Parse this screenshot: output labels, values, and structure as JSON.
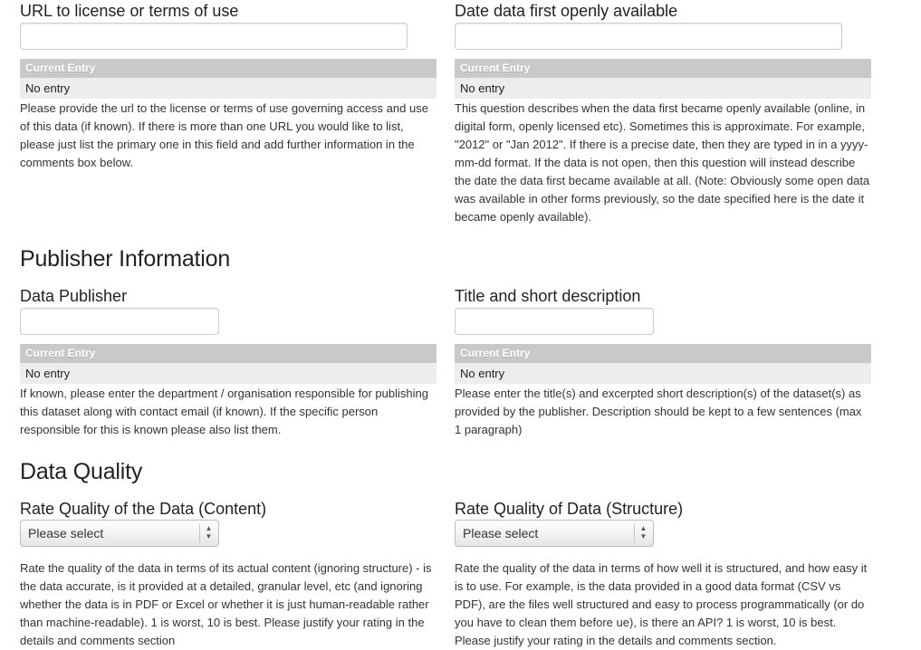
{
  "entry_header": "Current Entry",
  "license_url": {
    "label": "URL to license or terms of use",
    "value": "",
    "current_entry": "No entry",
    "help": "Please provide the url to the license or terms of use governing access and use of this data (if known). If there is more than one URL you would like to list, please just list the primary one in this field and add further information in the comments box below."
  },
  "date_available": {
    "label": "Date data first openly available",
    "value": "",
    "current_entry": "No entry",
    "help": "This question describes when the data first became openly available (online, in digital form, openly licensed etc). Sometimes this is approximate. For example, \"2012\" or \"Jan 2012\". If there is a precise date, then they are typed in in a yyyy-mm-dd format. If the data is not open, then this question will instead describe the date the data first became available at all. (Note: Obviously some open data was available in other forms previously, so the date specified here is the date it became openly available)."
  },
  "publisher_section": {
    "title": "Publisher Information"
  },
  "data_publisher": {
    "label": "Data Publisher",
    "value": "",
    "current_entry": "No entry",
    "help": "If known, please enter the department / organisation responsible for publishing this dataset along with contact email (if known). If the specific person responsible for this is known please also list them."
  },
  "title_description": {
    "label": "Title and short description",
    "value": "",
    "current_entry": "No entry",
    "help": "Please enter the title(s) and excerpted short description(s) of the dataset(s) as provided by the publisher. Description should be kept to a few sentences (max 1 paragraph)"
  },
  "quality_section": {
    "title": "Data Quality"
  },
  "quality_content": {
    "label": "Rate Quality of the Data (Content)",
    "selected": "Please select",
    "help": "Rate the quality of the data in terms of its actual content (ignoring structure) - is the data accurate, is it provided at a detailed, granular level, etc (and ignoring whether the data is in PDF or Excel or whether it is just human-readable rather than machine-readable). 1 is worst, 10 is best. Please justify your rating in the details and comments section"
  },
  "quality_structure": {
    "label": "Rate Quality of Data (Structure)",
    "selected": "Please select",
    "help": "Rate the quality of the data in terms of how well it is structured, and how easy it is to use. For example, is the data provided in a good data format (CSV vs PDF), are the files well structured and easy to process programmatically (or do you have to clean them before ue), is there an API? 1 is worst, 10 is best. Please justify your rating in the details and comments section."
  }
}
